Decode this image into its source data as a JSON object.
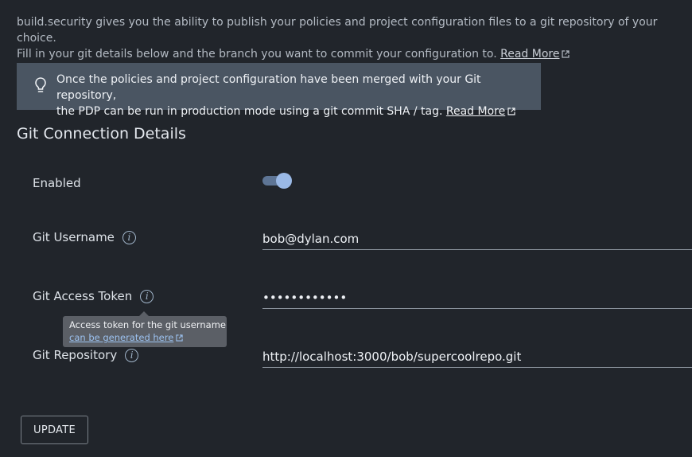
{
  "intro": {
    "line1": "build.security gives you the ability to publish your policies and project configuration files to a git repository of your choice.",
    "line2": "Fill in your git details below and the branch you want to commit your configuration to.",
    "read_more": "Read More"
  },
  "info_box": {
    "line1": "Once the policies and project configuration have been merged with your Git repository,",
    "line2": "the PDP can be run in production mode using a git commit SHA / tag.",
    "read_more": "Read More",
    "icon": "lightbulb-icon"
  },
  "section_title": "Git Connection Details",
  "fields": {
    "enabled": {
      "label": "Enabled",
      "value": true
    },
    "username": {
      "label": "Git Username",
      "value": "bob@dylan.com"
    },
    "token": {
      "label": "Git Access Token",
      "value": "••••••••••••"
    },
    "repository": {
      "label": "Git Repository",
      "value": "http://localhost:3000/bob/supercoolrepo.git"
    }
  },
  "tooltip": {
    "line1": "Access token for the git username",
    "link": "can be generated here"
  },
  "update_button": "UPDATE",
  "colors": {
    "background": "#21252b",
    "info_box": "#4a5562",
    "toggle_thumb": "#9ab9e6",
    "tooltip_link": "#9cc2f0"
  }
}
